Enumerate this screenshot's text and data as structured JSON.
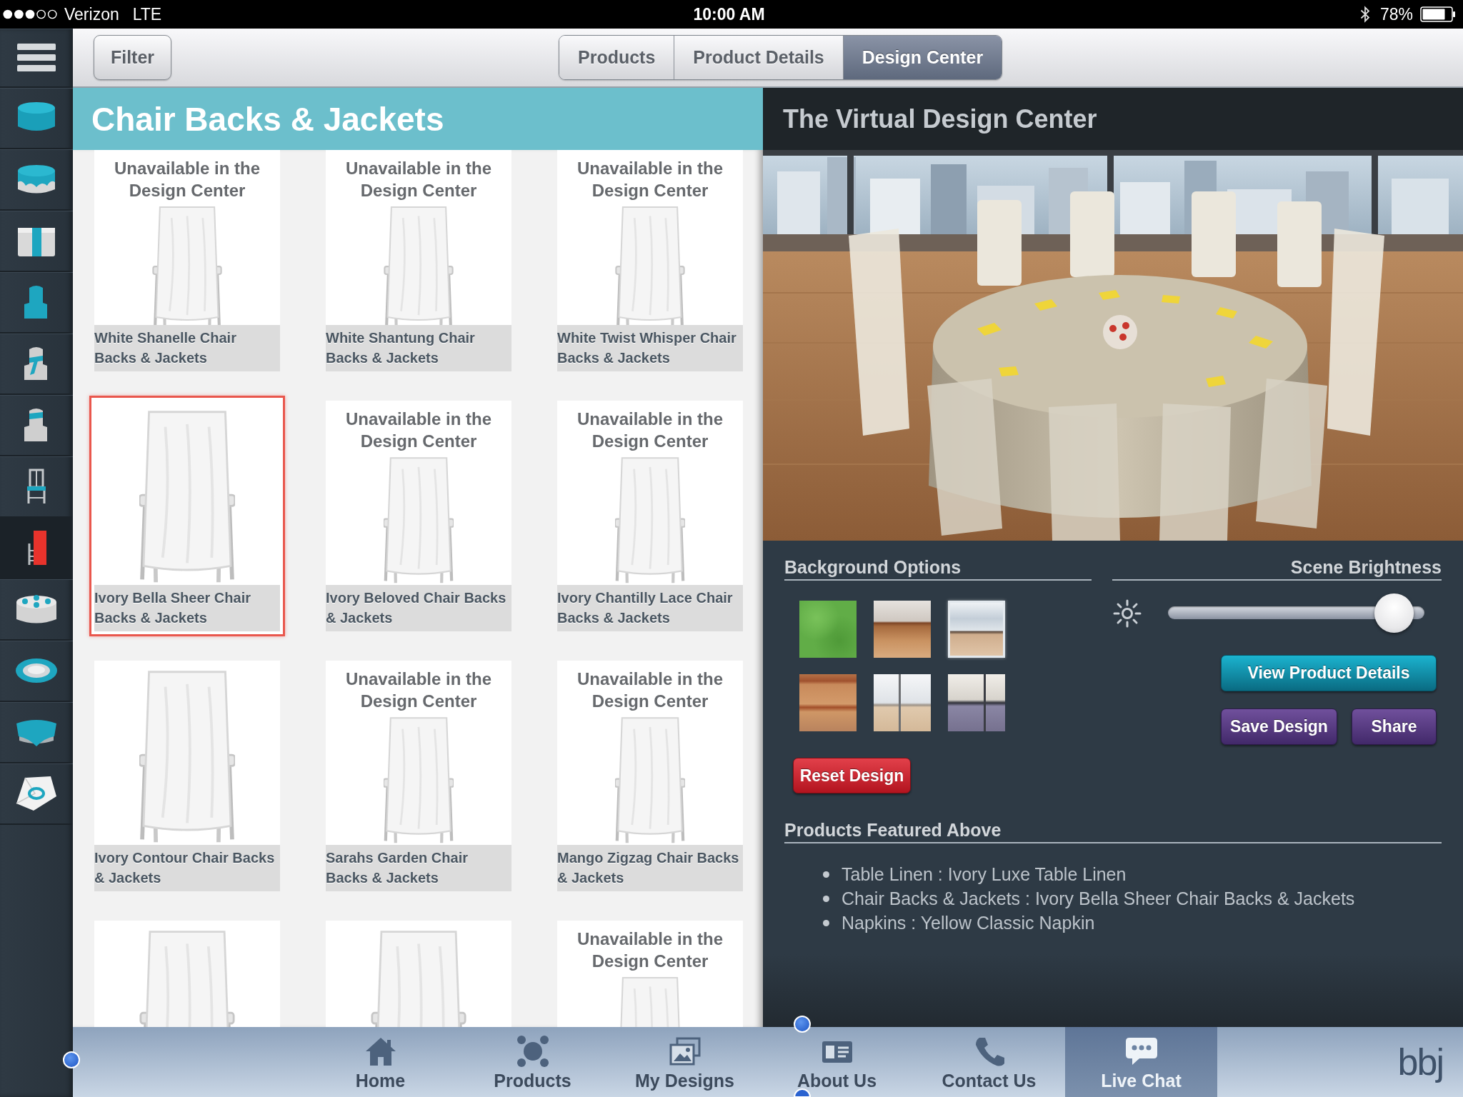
{
  "status_bar": {
    "carrier": "Verizon",
    "network": "LTE",
    "time": "10:00 AM",
    "battery": "78%"
  },
  "sidebar": {
    "items": [
      {
        "kind": "tablecloth",
        "selected": false
      },
      {
        "kind": "overlay",
        "selected": false
      },
      {
        "kind": "runner",
        "selected": false
      },
      {
        "kind": "chair-cover",
        "selected": false
      },
      {
        "kind": "chair-sash",
        "selected": false
      },
      {
        "kind": "chair-band",
        "selected": false
      },
      {
        "kind": "chair",
        "selected": false
      },
      {
        "kind": "chair-back",
        "selected": true
      },
      {
        "kind": "centerpieces",
        "selected": false
      },
      {
        "kind": "charger",
        "selected": false
      },
      {
        "kind": "topper",
        "selected": false
      },
      {
        "kind": "napkin",
        "selected": false
      }
    ]
  },
  "toolbar": {
    "filter_button": "Filter",
    "tabs": [
      {
        "label": "Products",
        "selected": false
      },
      {
        "label": "Product Details",
        "selected": false
      },
      {
        "label": "Design Center",
        "selected": true
      }
    ]
  },
  "catalog": {
    "title": "Chair Backs & Jackets",
    "products": [
      {
        "name": "White Shanelle Chair Backs & Jackets",
        "notice": "Unavailable in the Design Center",
        "selected": false
      },
      {
        "name": "White Shantung Chair Backs & Jackets",
        "notice": "Unavailable in the Design Center",
        "selected": false
      },
      {
        "name": "White Twist Whisper Chair Backs & Jackets",
        "notice": "Unavailable in the Design Center",
        "selected": false
      },
      {
        "name": "Ivory Bella Sheer Chair Backs & Jackets",
        "selected": true
      },
      {
        "name": "Ivory Beloved Chair Backs & Jackets",
        "notice": "Unavailable in the Design Center",
        "selected": false
      },
      {
        "name": "Ivory Chantilly Lace Chair Backs & Jackets",
        "notice": "Unavailable in the Design Center",
        "selected": false
      },
      {
        "name": "Ivory Contour Chair Backs & Jackets",
        "selected": false
      },
      {
        "name": "Sarahs Garden Chair Backs & Jackets",
        "notice": "Unavailable in the Design Center",
        "selected": false
      },
      {
        "name": "Mango Zigzag Chair Backs & Jackets",
        "notice": "Unavailable in the Design Center",
        "selected": false
      },
      {
        "selected": false
      },
      {
        "selected": false
      },
      {
        "notice": "Unavailable in the Design Center",
        "selected": false
      }
    ]
  },
  "design_center": {
    "title": "The Virtual Design Center",
    "background_options": {
      "title": "Background Options",
      "swatches": [
        {
          "kind": "grass",
          "selected": false
        },
        {
          "kind": "wood-wall",
          "selected": false
        },
        {
          "kind": "city-window",
          "selected": true
        },
        {
          "kind": "wood-panel",
          "selected": false
        },
        {
          "kind": "window-floor",
          "selected": false
        },
        {
          "kind": "dusk-window",
          "selected": false
        }
      ]
    },
    "brightness": {
      "title": "Scene Brightness",
      "level": 0.95
    },
    "view_details_button": "View Product Details",
    "save_button": "Save Design",
    "share_button": "Share",
    "reset_button": "Reset Design",
    "featured": {
      "title": "Products Featured Above",
      "items": [
        "Table Linen : Ivory Luxe Table Linen",
        "Chair Backs & Jackets : Ivory Bella Sheer Chair Backs & Jackets",
        "Napkins : Yellow Classic Napkin"
      ]
    }
  },
  "tab_bar": {
    "tabs": [
      {
        "kind": "home",
        "label": "Home",
        "selected": false
      },
      {
        "kind": "products",
        "label": "Products",
        "selected": false
      },
      {
        "kind": "designs",
        "label": "My Designs",
        "selected": false
      },
      {
        "kind": "about",
        "label": "About Us",
        "selected": false
      },
      {
        "kind": "contact",
        "label": "Contact Us",
        "selected": false
      },
      {
        "kind": "chat",
        "label": "Live Chat",
        "selected": true
      }
    ],
    "logo": "bbj"
  }
}
